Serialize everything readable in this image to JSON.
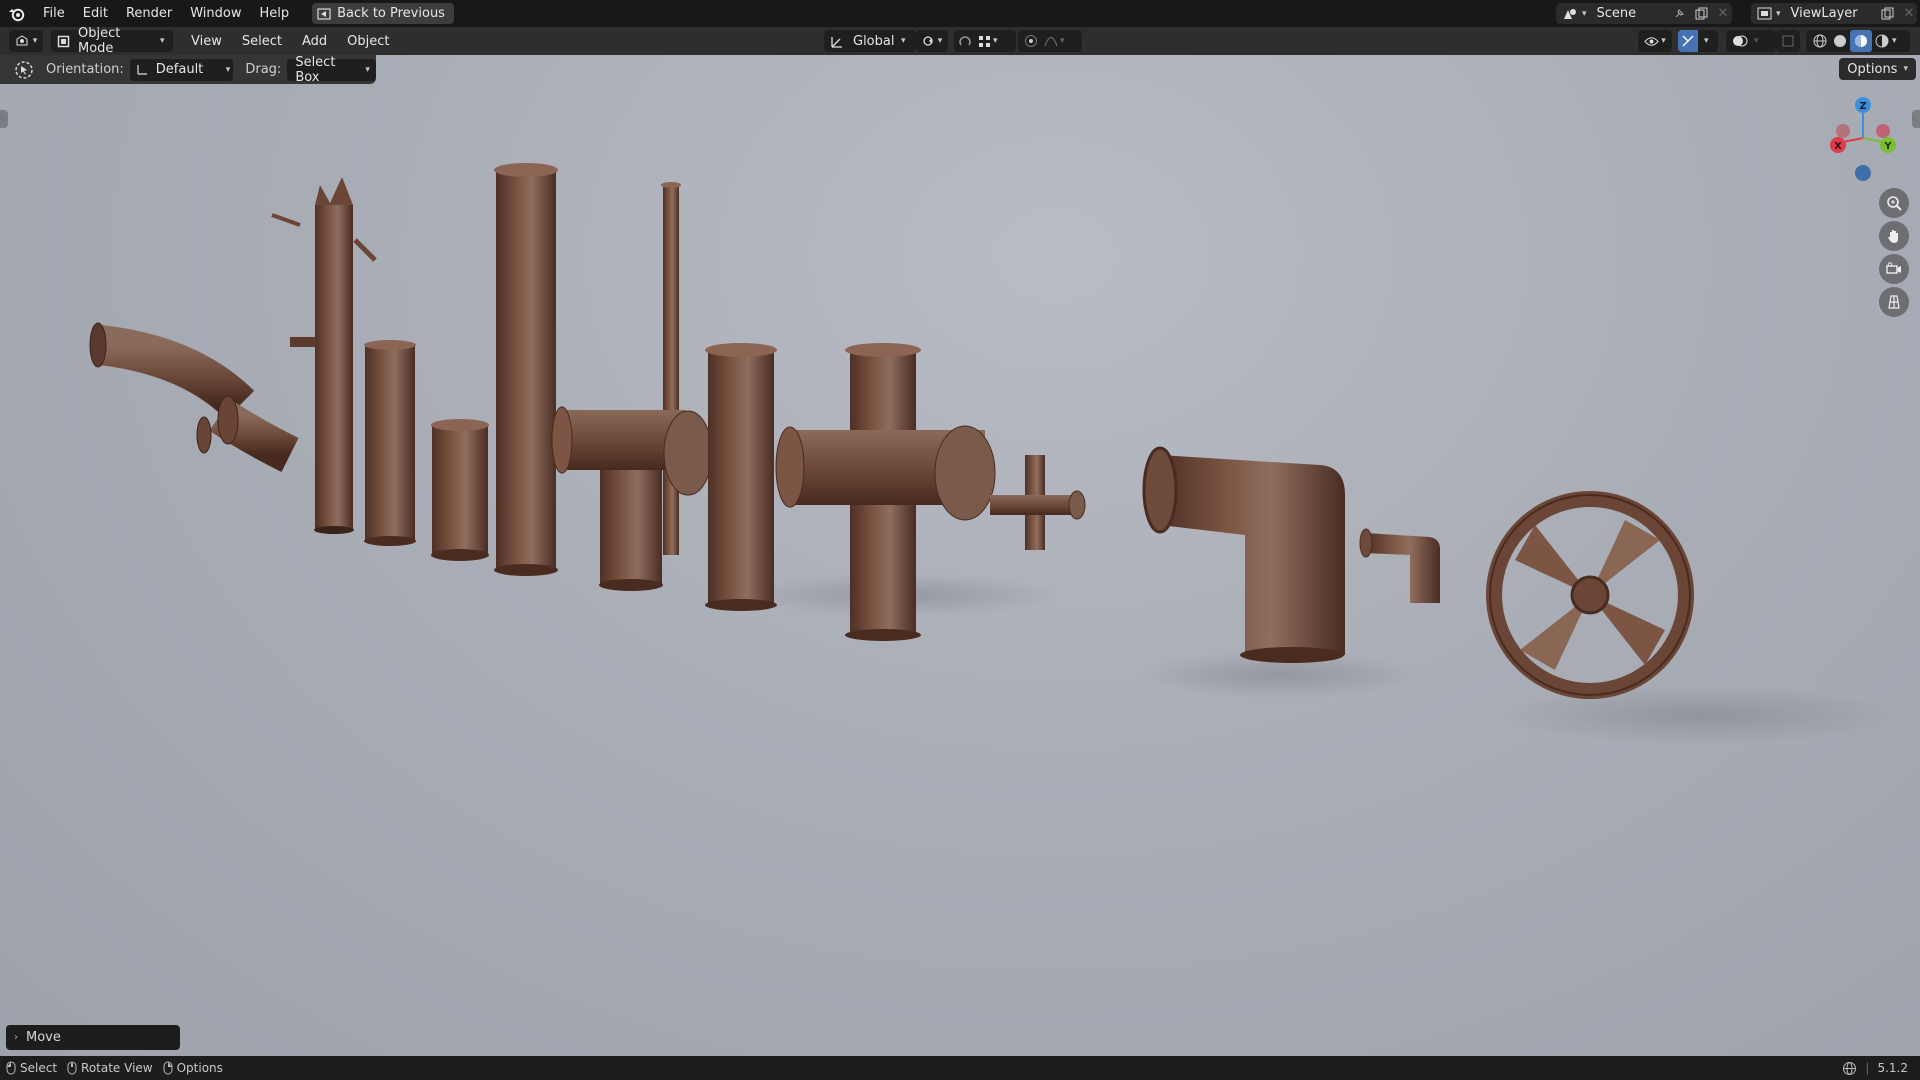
{
  "menu": {
    "file": "File",
    "edit": "Edit",
    "render": "Render",
    "window": "Window",
    "help": "Help",
    "back": "Back to Previous"
  },
  "scene": {
    "label": "Scene"
  },
  "view_layer": {
    "label": "ViewLayer"
  },
  "header": {
    "mode": "Object Mode",
    "view": "View",
    "select": "Select",
    "add": "Add",
    "object": "Object",
    "transform": "Global"
  },
  "tool": {
    "orientation_label": "Orientation:",
    "orientation_value": "Default",
    "drag_label": "Drag:",
    "drag_value": "Select Box",
    "options": "Options"
  },
  "gizmo": {
    "x": "X",
    "y": "Y",
    "z": "Z"
  },
  "last_op": {
    "label": "Move"
  },
  "status": {
    "select": "Select",
    "rotate": "Rotate View",
    "options": "Options",
    "version": "5.1.2"
  },
  "colors": {
    "topbar": "#181818",
    "header": "#2e2e2e",
    "accent": "#4772b3",
    "axis_x": "#e13a4b",
    "axis_y": "#7bbe2f",
    "axis_z": "#3d8fdc",
    "rust": "#6f4432"
  }
}
